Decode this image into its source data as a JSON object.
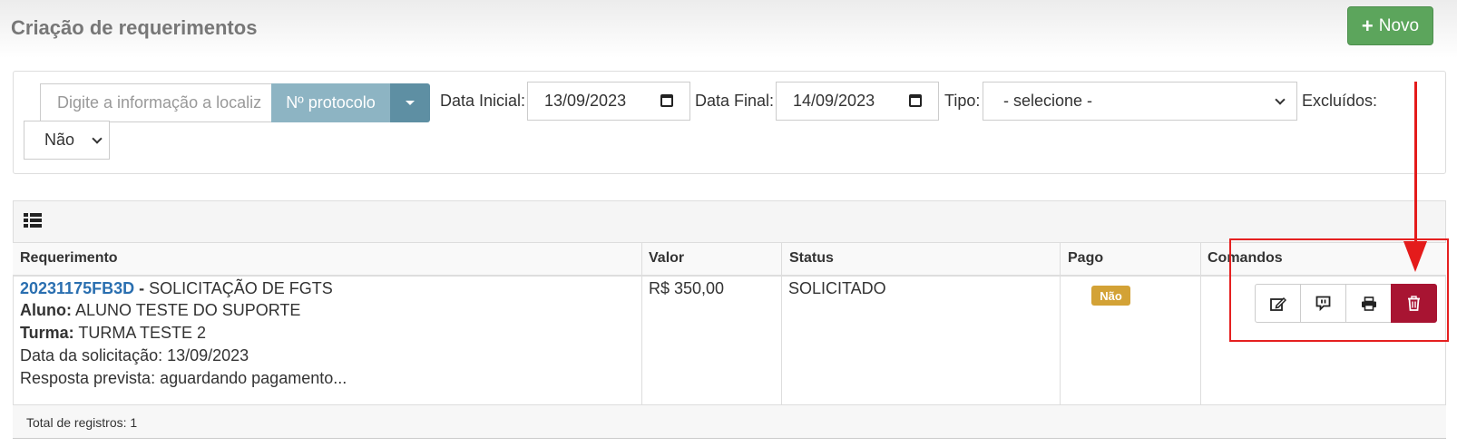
{
  "header": {
    "title": "Criação de requerimentos",
    "new_button_label": "Novo",
    "new_button_icon": "plus-icon"
  },
  "filters": {
    "search_placeholder": "Digite a informação a localiz",
    "search_by_button": "Nº protocolo",
    "start_date_label": "Data Inicial:",
    "start_date_value": "13/09/2023",
    "end_date_label": "Data Final:",
    "end_date_value": "14/09/2023",
    "type_label": "Tipo:",
    "type_value": "- selecione -",
    "deleted_label": "Excluídos:",
    "deleted_value": "Não"
  },
  "table": {
    "header_icon": "list-icon",
    "columns": [
      "Requerimento",
      "Valor",
      "Status",
      "Pago",
      "Comandos"
    ],
    "rows": [
      {
        "code": "20231175FB3D",
        "code_sep": " - ",
        "description": "SOLICITAÇÃO DE FGTS",
        "student_label": "Aluno:",
        "student": "ALUNO TESTE DO SUPORTE",
        "class_label": "Turma:",
        "class": "TURMA TESTE 2",
        "request_date": "Data da solicitação: 13/09/2023",
        "expected_response": "Resposta prevista: aguardando pagamento...",
        "value": "R$ 350,00",
        "status": "SOLICITADO",
        "paid": "Não",
        "commands": [
          "edit-icon",
          "comment-icon",
          "print-icon",
          "trash-icon"
        ]
      }
    ],
    "total_text": "Total de registros: 1"
  },
  "colors": {
    "new_button": "#5ca55c",
    "search_button": "#8db4c3",
    "search_caret": "#5e8fa3",
    "link": "#2a6fb0",
    "paid_badge": "#d3a236",
    "delete_button": "#a81432",
    "annotation": "#e41b1b"
  }
}
